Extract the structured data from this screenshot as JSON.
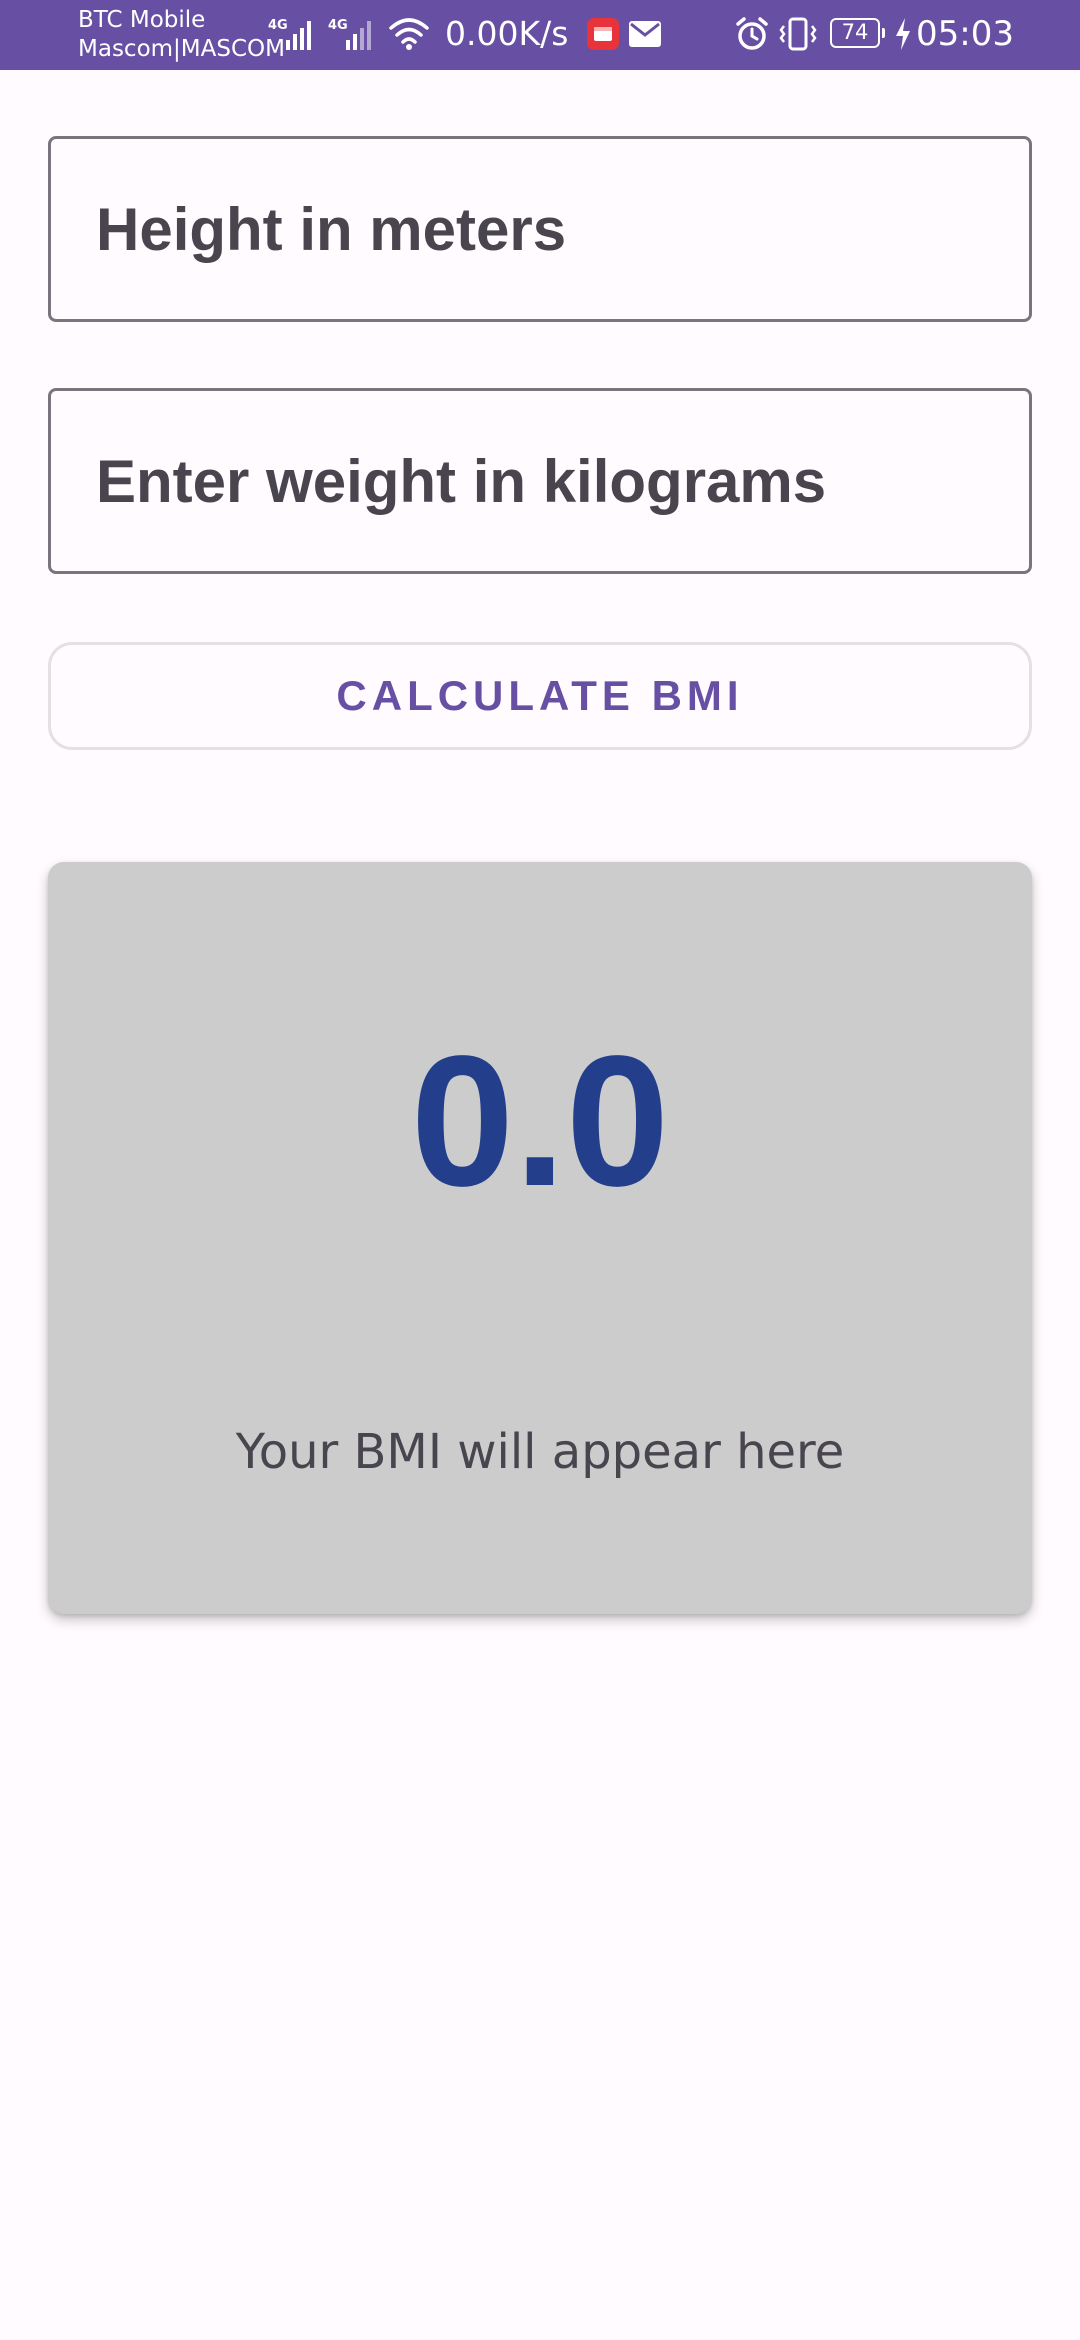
{
  "status_bar": {
    "carrier_line1": "BTC Mobile",
    "carrier_line2": "Mascom|MASCOM",
    "network_type_1": "4G",
    "network_type_2": "4G",
    "net_speed": "0.00K/s",
    "battery_level": "74",
    "time": "05:03",
    "icons": [
      "signal-icon",
      "wifi-icon",
      "notification-app-icon",
      "mail-icon",
      "alarm-icon",
      "vibrate-icon",
      "battery-icon",
      "charging-icon"
    ]
  },
  "form": {
    "height_placeholder": "Height in meters",
    "height_value": "",
    "weight_placeholder": "Enter weight in kilograms",
    "weight_value": "",
    "calculate_label": "CALCULATE BMI"
  },
  "result": {
    "value": "0.0",
    "message": "Your BMI will appear here"
  },
  "colors": {
    "primary": "#6750a4",
    "bmi_value": "#233f8c",
    "card_background": "#cccccc",
    "text": "#49454f",
    "background": "#fffbfe"
  }
}
